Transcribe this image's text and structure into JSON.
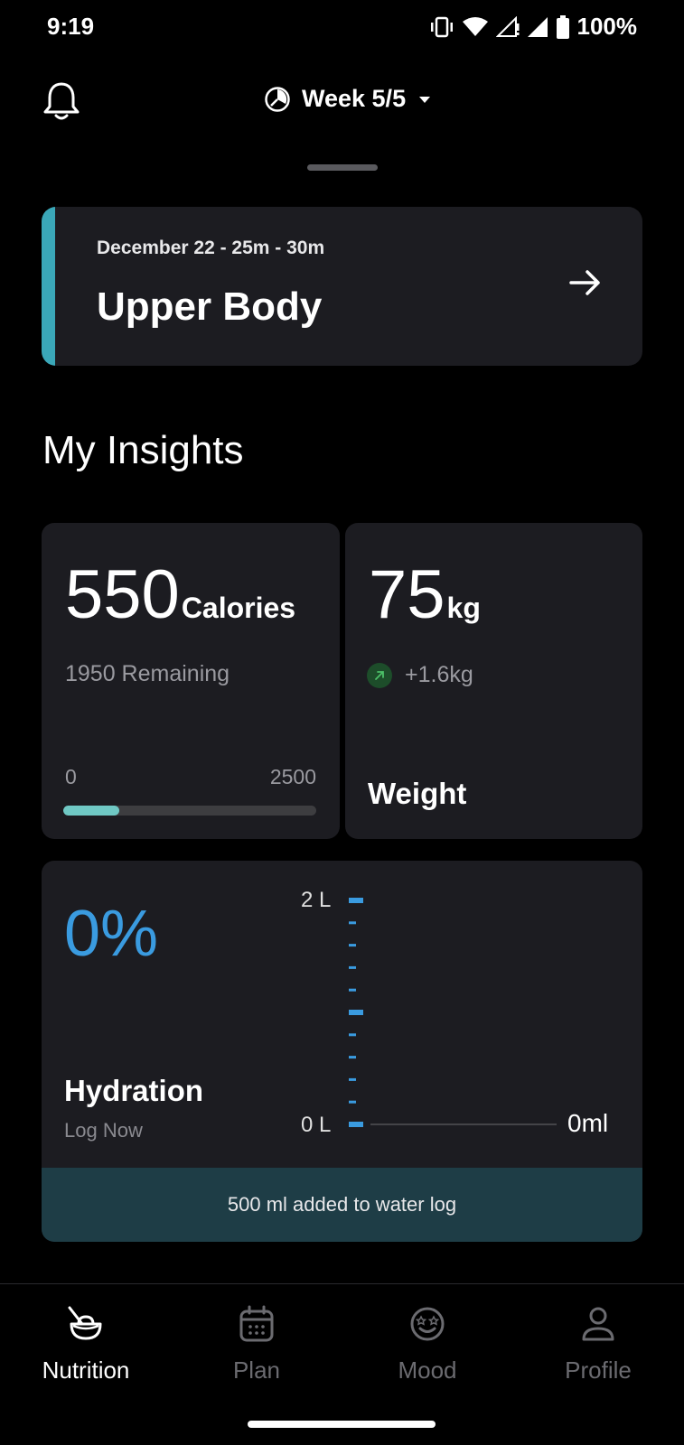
{
  "status_bar": {
    "time": "9:19",
    "battery": "100%",
    "icons": [
      "vibrate-icon",
      "wifi-icon",
      "signal-icon",
      "signal-full-icon",
      "battery-icon"
    ]
  },
  "header": {
    "week_label": "Week 5/5",
    "icons": [
      "bell-icon",
      "clock-icon",
      "caret-down-icon"
    ]
  },
  "workout": {
    "meta": "December 22 - 25m - 30m",
    "title": "Upper Body",
    "accent_color": "#3aa7b8"
  },
  "insights": {
    "title": "My Insights",
    "calories": {
      "value": "550",
      "unit": "Calories",
      "remaining": "1950 Remaining",
      "min": "0",
      "max": "2500",
      "progress_fraction": 0.22,
      "progress_color": "#6fc8c4"
    },
    "weight": {
      "value": "75",
      "unit": "kg",
      "change": "+1.6kg",
      "label": "Weight",
      "trend": "up"
    },
    "hydration": {
      "percent": "0%",
      "title": "Hydration",
      "log_link": "Log Now",
      "gauge_top": "2 L",
      "gauge_bottom": "0 L",
      "current_value": "0ml",
      "accent_color": "#3a9be0"
    },
    "toast": "500 ml added to water log"
  },
  "bottom_nav": {
    "items": [
      {
        "label": "Nutrition",
        "icon": "nutrition-bowl-icon",
        "active": true
      },
      {
        "label": "Plan",
        "icon": "calendar-icon",
        "active": false
      },
      {
        "label": "Mood",
        "icon": "mood-face-icon",
        "active": false
      },
      {
        "label": "Profile",
        "icon": "profile-icon",
        "active": false
      }
    ]
  }
}
